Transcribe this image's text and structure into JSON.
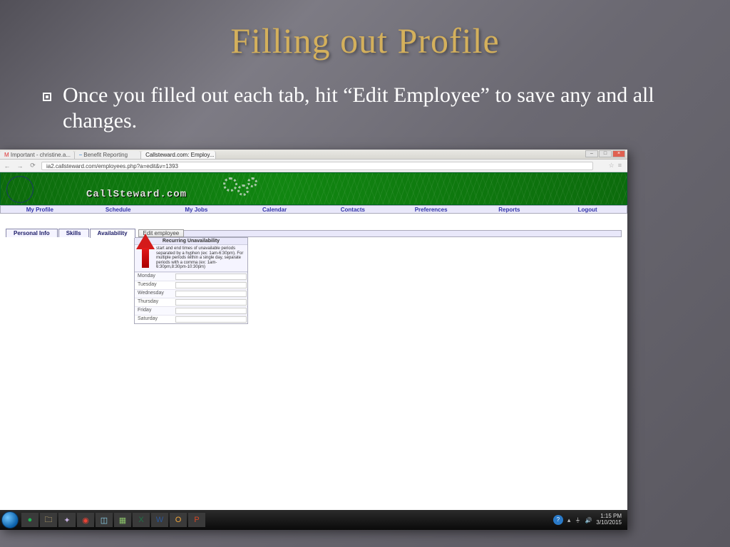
{
  "slide": {
    "title": "Filling out Profile",
    "bullet": "Once you filled out each tab, hit “Edit Employee” to save any and all changes."
  },
  "browser": {
    "tabs": [
      "Important - christine.a...",
      "Benefit Reporting",
      "Callsteward.com: Employ..."
    ],
    "url": "ia2.callsteward.com/employees.php?a=edit&v=1393"
  },
  "banner": {
    "brand": "CallSteward.com"
  },
  "topnav": [
    "My Profile",
    "Schedule",
    "My Jobs",
    "Calendar",
    "Contacts",
    "Preferences",
    "Reports",
    "Logout"
  ],
  "profileTabs": {
    "items": [
      "Personal Info",
      "Skills",
      "Availability"
    ],
    "activeIndex": 2,
    "editButton": "Edit employee"
  },
  "availability": {
    "header": "Recurring Unavailability",
    "hint": "start and end times of unavailable periods separated by a hyphen (ex: 1am-6:30pm). For multiple periods within a single day, separate periods with a comma (ex: 1am-6:30pm,8:30pm-10:30pm)",
    "days": [
      "Monday",
      "Tuesday",
      "Wednesday",
      "Thursday",
      "Friday",
      "Saturday"
    ]
  },
  "system": {
    "time": "1:15 PM",
    "date": "3/10/2015"
  }
}
